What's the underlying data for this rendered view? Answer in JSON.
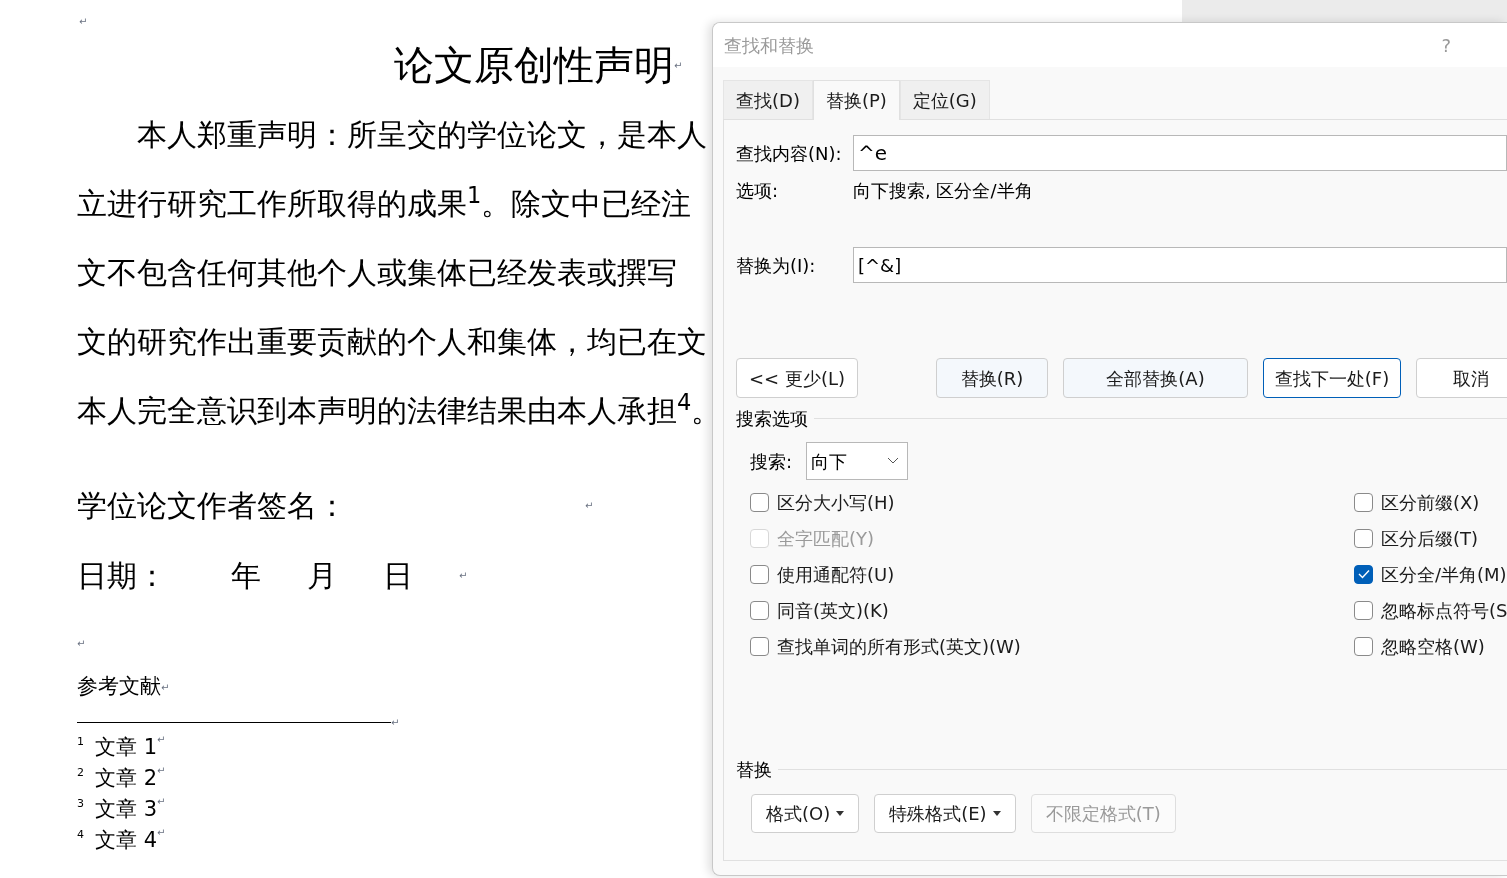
{
  "document": {
    "top_mark": "↵",
    "title": "论文原创性声明",
    "title_mark": "↵",
    "paragraph": [
      {
        "text": "本人郑重声明：所呈交的学位论文，是本人",
        "indent": true
      },
      {
        "text": "立进行研究工作所取得的成果$^{1}$。除文中已经注",
        "indent": false
      },
      {
        "text": "文不包含任何其他个人或集体已经发表或撰写",
        "indent": false
      },
      {
        "text": "文的研究作出重要贡献的个人和集体，均已在文",
        "indent": false
      },
      {
        "text": "本人完全意识到本声明的法律结果由本人承担$^{4}$。",
        "indent": false
      }
    ],
    "signature": "学位论文作者签名：",
    "signature_mark": "↵",
    "date": [
      "日期：",
      "年",
      "月",
      "日"
    ],
    "date_mark": "↵",
    "blank_mark": "↵",
    "references_title": "参考文献",
    "references_mark": "↵",
    "separator_mark": "↵",
    "footnotes": [
      {
        "number": "1",
        "text": "文章 1",
        "mark": "↵"
      },
      {
        "number": "2",
        "text": "文章 2",
        "mark": "↵"
      },
      {
        "number": "3",
        "text": "文章 3",
        "mark": "↵"
      },
      {
        "number": "4",
        "text": "文章 4",
        "mark": "↵"
      }
    ]
  },
  "dialog": {
    "title": "查找和替换",
    "help": "?",
    "tabs": [
      {
        "label": "查找(D)",
        "selected": false
      },
      {
        "label": "替换(P)",
        "selected": true
      },
      {
        "label": "定位(G)",
        "selected": false
      }
    ],
    "find": {
      "label": "查找内容(N):",
      "value": "^e"
    },
    "options": {
      "label": "选项:",
      "value": "向下搜索, 区分全/半角"
    },
    "replace": {
      "label": "替换为(I):",
      "value": "[^&]"
    },
    "buttons": [
      {
        "label": "<< 更少(L)",
        "kind": "plain",
        "default": false
      },
      {
        "label": "替换(R)",
        "kind": "tinted",
        "default": false
      },
      {
        "label": "全部替换(A)",
        "kind": "tinted",
        "default": false
      },
      {
        "label": "查找下一处(F)",
        "kind": "plain",
        "default": true
      },
      {
        "label": "取消",
        "kind": "plain",
        "default": false
      }
    ],
    "search_options": {
      "title": "搜索选项",
      "search_label": "搜索:",
      "search_value": "向下",
      "left": [
        {
          "label": "区分大小写(H)",
          "checked": false,
          "disabled": false
        },
        {
          "label": "全字匹配(Y)",
          "checked": false,
          "disabled": true
        },
        {
          "label": "使用通配符(U)",
          "checked": false,
          "disabled": false
        },
        {
          "label": "同音(英文)(K)",
          "checked": false,
          "disabled": false
        },
        {
          "label": "查找单词的所有形式(英文)(W)",
          "checked": false,
          "disabled": false
        }
      ],
      "right": [
        {
          "label": "区分前缀(X)",
          "checked": false,
          "disabled": false
        },
        {
          "label": "区分后缀(T)",
          "checked": false,
          "disabled": false
        },
        {
          "label": "区分全/半角(M)",
          "checked": true,
          "disabled": false
        },
        {
          "label": "忽略标点符号(S",
          "checked": false,
          "disabled": false
        },
        {
          "label": "忽略空格(W)",
          "checked": false,
          "disabled": false
        }
      ]
    },
    "replace_section": {
      "title": "替换",
      "buttons": [
        {
          "label": "格式(O)",
          "menu": true,
          "disabled": false
        },
        {
          "label": "特殊格式(E)",
          "menu": true,
          "disabled": false
        },
        {
          "label": "不限定格式(T)",
          "menu": false,
          "disabled": true
        }
      ]
    }
  }
}
